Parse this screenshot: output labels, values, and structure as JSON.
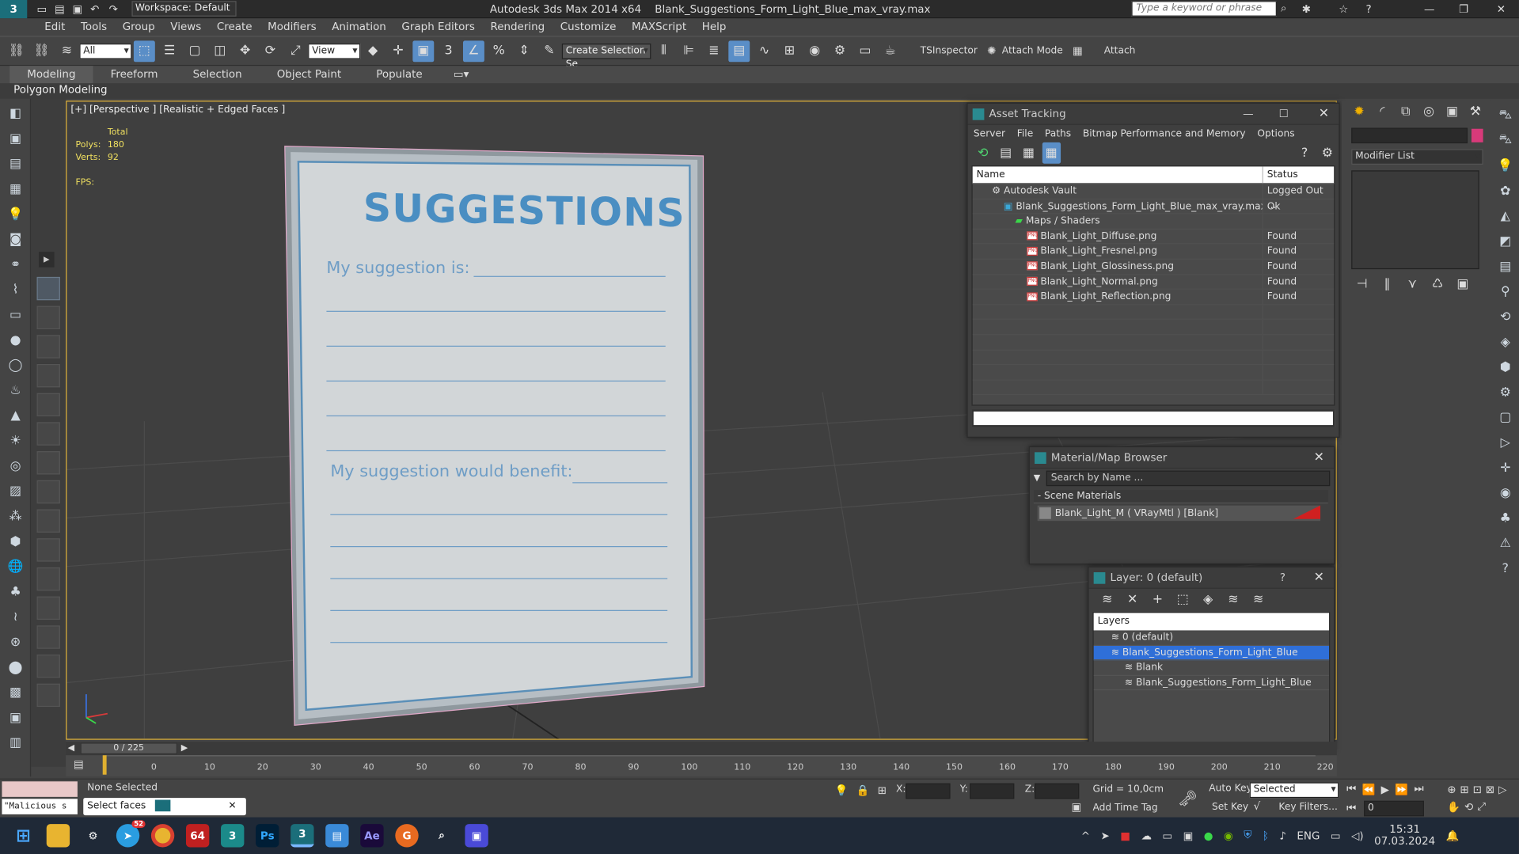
{
  "window": {
    "title": "Autodesk 3ds Max  2014 x64",
    "file": "Blank_Suggestions_Form_Light_Blue_max_vray.max",
    "workspace": "Workspace: Default",
    "search_placeholder": "Type a keyword or phrase"
  },
  "menu": [
    "Edit",
    "Tools",
    "Group",
    "Views",
    "Create",
    "Modifiers",
    "Animation",
    "Graph Editors",
    "Rendering",
    "Customize",
    "MAXScript",
    "Help"
  ],
  "toolbar": {
    "filter": "All",
    "ref_coord": "View",
    "selection_set": "Create Selection Se",
    "tsinspector": "TSInspector",
    "attach_mode": "Attach Mode",
    "attach": "Attach"
  },
  "ribbon": {
    "tabs": [
      "Modeling",
      "Freeform",
      "Selection",
      "Object Paint",
      "Populate"
    ],
    "sub": "Polygon Modeling"
  },
  "viewport": {
    "label": "[+] [Perspective ] [Realistic + Edged Faces ]",
    "total": "Total",
    "polys_label": "Polys:",
    "polys": "180",
    "verts_label": "Verts:",
    "verts": "92",
    "fps": "FPS:"
  },
  "form": {
    "title": "SUGGESTIONS",
    "line1": "My suggestion is:",
    "line2": "My suggestion would benefit:"
  },
  "asset_tracking": {
    "title": "Asset Tracking",
    "menu": [
      "Server",
      "File",
      "Paths",
      "Bitmap Performance and Memory",
      "Options"
    ],
    "col_name": "Name",
    "col_status": "Status",
    "rows": [
      {
        "name": "Autodesk Vault",
        "status": "Logged Out ...",
        "indent": "1",
        "kind": "vault"
      },
      {
        "name": "Blank_Suggestions_Form_Light_Blue_max_vray.max",
        "status": "Ok",
        "indent": "2",
        "kind": "max"
      },
      {
        "name": "Maps / Shaders",
        "status": "",
        "indent": "3",
        "kind": "maps"
      },
      {
        "name": "Blank_Light_Diffuse.png",
        "status": "Found",
        "indent": "4",
        "kind": "png"
      },
      {
        "name": "Blank_Light_Fresnel.png",
        "status": "Found",
        "indent": "4",
        "kind": "png"
      },
      {
        "name": "Blank_Light_Glossiness.png",
        "status": "Found",
        "indent": "4",
        "kind": "png"
      },
      {
        "name": "Blank_Light_Normal.png",
        "status": "Found",
        "indent": "4",
        "kind": "png"
      },
      {
        "name": "Blank_Light_Reflection.png",
        "status": "Found",
        "indent": "4",
        "kind": "png"
      }
    ]
  },
  "material_browser": {
    "title": "Material/Map Browser",
    "search": "Search by Name ...",
    "section": "- Scene Materials",
    "item": "Blank_Light_M  ( VRayMtl ) [Blank]"
  },
  "layer": {
    "title": "Layer: 0 (default)",
    "header": "Layers",
    "items": [
      {
        "name": "0 (default)",
        "indent": "1",
        "selected": "false"
      },
      {
        "name": "Blank_Suggestions_Form_Light_Blue",
        "indent": "1",
        "selected": "true"
      },
      {
        "name": "Blank",
        "indent": "2",
        "selected": "false"
      },
      {
        "name": "Blank_Suggestions_Form_Light_Blue",
        "indent": "2",
        "selected": "false"
      }
    ]
  },
  "command_panel": {
    "modifier_list": "Modifier List"
  },
  "timeline": {
    "frame": "0 / 225",
    "ticks": [
      "0",
      "10",
      "20",
      "30",
      "40",
      "50",
      "60",
      "70",
      "80",
      "90",
      "100",
      "110",
      "120",
      "130",
      "140",
      "150",
      "160",
      "170",
      "180",
      "190",
      "200",
      "210",
      "220"
    ]
  },
  "status": {
    "none_selected": "None Selected",
    "select_faces": "Select faces",
    "maxscript": "\"Malicious s",
    "x": "X:",
    "y": "Y:",
    "z": "Z:",
    "grid": "Grid = 10,0cm",
    "add_time_tag": "Add Time Tag",
    "auto_key": "Auto Key",
    "selected": "Selected",
    "set_key": "Set Key",
    "key_filters": "Key Filters...",
    "frame_val": "0"
  },
  "taskbar": {
    "lang": "ENG",
    "time": "15:31",
    "date": "07.03.2024",
    "badge": "52",
    "app64": "64",
    "ps": "Ps",
    "ae": "Ae"
  }
}
